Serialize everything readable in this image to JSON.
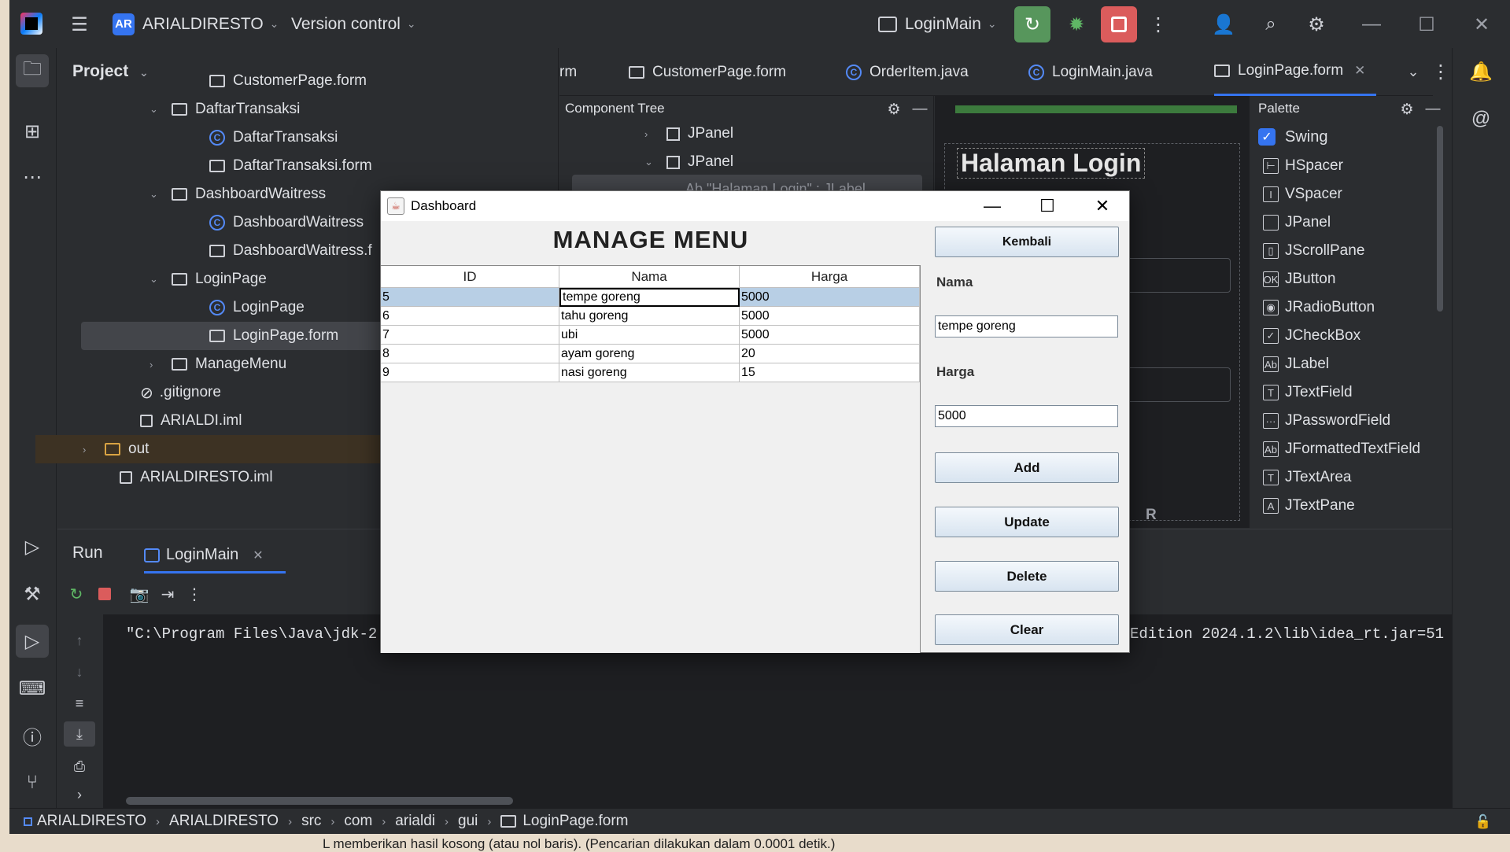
{
  "titlebar": {
    "project_initials": "AR",
    "project_name": "ARIALDIRESTO",
    "vcs": "Version control",
    "run_config": "LoginMain"
  },
  "project_pane": {
    "title": "Project",
    "items": [
      {
        "label": "CustomerPage.form",
        "type": "form"
      },
      {
        "label": "DaftarTransaksi",
        "type": "package"
      },
      {
        "label": "DaftarTransaksi",
        "type": "class"
      },
      {
        "label": "DaftarTransaksi.form",
        "type": "form"
      },
      {
        "label": "DashboardWaitress",
        "type": "package"
      },
      {
        "label": "DashboardWaitress",
        "type": "class"
      },
      {
        "label": "DashboardWaitress.f",
        "type": "form"
      },
      {
        "label": "LoginPage",
        "type": "package"
      },
      {
        "label": "LoginPage",
        "type": "class"
      },
      {
        "label": "LoginPage.form",
        "type": "form"
      },
      {
        "label": "ManageMenu",
        "type": "package"
      },
      {
        "label": ".gitignore",
        "type": "ignore"
      },
      {
        "label": "ARIALDI.iml",
        "type": "iml"
      },
      {
        "label": "out",
        "type": "folder"
      },
      {
        "label": "ARIALDIRESTO.iml",
        "type": "iml"
      }
    ]
  },
  "editor_tabs": [
    "rm",
    "CustomerPage.form",
    "OrderItem.java",
    "LoginMain.java",
    "LoginPage.form"
  ],
  "component_tree": {
    "title": "Component Tree",
    "rows": [
      "JPanel",
      "JPanel"
    ],
    "partial": "Ab \"Halaman Login\" : JLabel"
  },
  "designer": {
    "heading": "Halaman Login",
    "partial_text": "R"
  },
  "palette": {
    "title": "Palette",
    "group": "Swing",
    "items": [
      {
        "label": "HSpacer",
        "icon": "⊢"
      },
      {
        "label": "VSpacer",
        "icon": "I"
      },
      {
        "label": "JPanel",
        "icon": ""
      },
      {
        "label": "JScrollPane",
        "icon": "▯"
      },
      {
        "label": "JButton",
        "icon": "OK"
      },
      {
        "label": "JRadioButton",
        "icon": "◉"
      },
      {
        "label": "JCheckBox",
        "icon": "✓"
      },
      {
        "label": "JLabel",
        "icon": "Ab"
      },
      {
        "label": "JTextField",
        "icon": "T"
      },
      {
        "label": "JPasswordField",
        "icon": "···"
      },
      {
        "label": "JFormattedTextField",
        "icon": "Ab"
      },
      {
        "label": "JTextArea",
        "icon": "T"
      },
      {
        "label": "JTextPane",
        "icon": "A"
      }
    ]
  },
  "run_panel": {
    "title": "Run",
    "tab": "LoginMain",
    "console_line_left": "\"C:\\Program Files\\Java\\jdk-2",
    "console_line_right": "Edition 2024.1.2\\lib\\idea_rt.jar=51"
  },
  "statusbar": {
    "breadcrumb": [
      "ARIALDIRESTO",
      "ARIALDIRESTO",
      "src",
      "com",
      "arialdi",
      "gui",
      "LoginPage.form"
    ]
  },
  "background_text": "L memberikan hasil kosong (atau nol baris). (Pencarian dilakukan dalam 0.0001 detik.)",
  "dialog": {
    "title": "Dashboard",
    "heading": "MANAGE MENU",
    "columns": [
      "ID",
      "Nama",
      "Harga"
    ],
    "rows": [
      [
        "5",
        "tempe goreng",
        "5000"
      ],
      [
        "6",
        "tahu goreng",
        "5000"
      ],
      [
        "7",
        "ubi",
        "5000"
      ],
      [
        "8",
        "ayam goreng",
        "20"
      ],
      [
        "9",
        "nasi goreng",
        "15"
      ]
    ],
    "back_button": "Kembali",
    "nama_label": "Nama",
    "nama_value": "tempe goreng",
    "harga_label": "Harga",
    "harga_value": "5000",
    "add_button": "Add",
    "update_button": "Update",
    "delete_button": "Delete",
    "clear_button": "Clear"
  }
}
